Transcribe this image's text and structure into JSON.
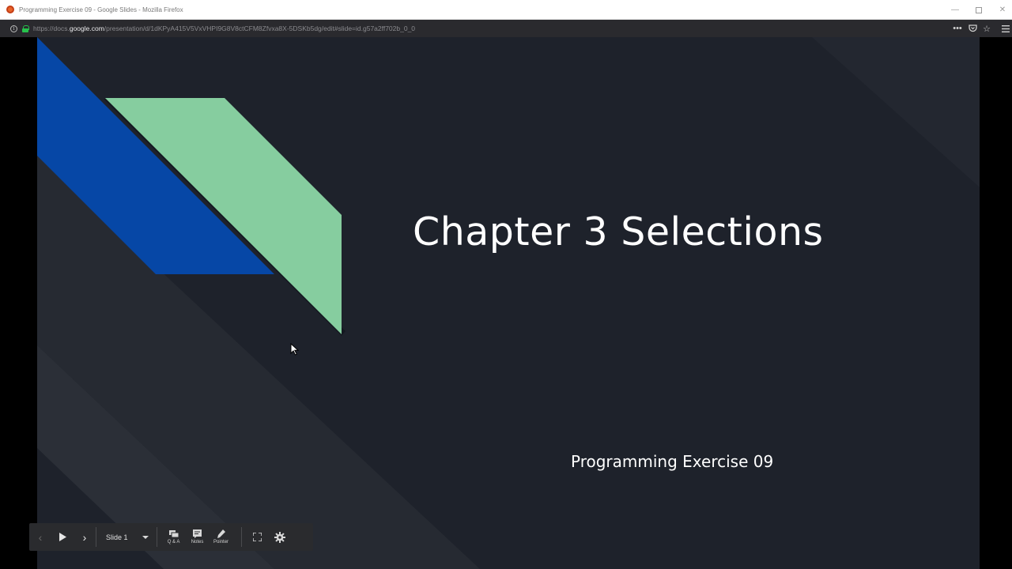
{
  "window": {
    "title": "Programming Exercise 09 - Google Slides - Mozilla Firefox"
  },
  "address_bar": {
    "url_prefix": "https://docs.",
    "url_domain": "google.com",
    "url_path": "/presentation/d/1dKPyA415V5VxVHPI9G8V8ctCFM8Zfvxa8X-5DSKb5dg/edit#slide=id.g57a2ff702b_0_0"
  },
  "slide": {
    "title": "Chapter 3 Selections",
    "subtitle": "Programming Exercise 09",
    "colors": {
      "background": "#1e222b",
      "blue_shape": "#0647a6",
      "green_shape": "#86cd9f"
    }
  },
  "presenter_toolbar": {
    "current_slide": "Slide 1",
    "qa_label": "Q & A",
    "notes_label": "Notes",
    "pointer_label": "Pointer"
  }
}
